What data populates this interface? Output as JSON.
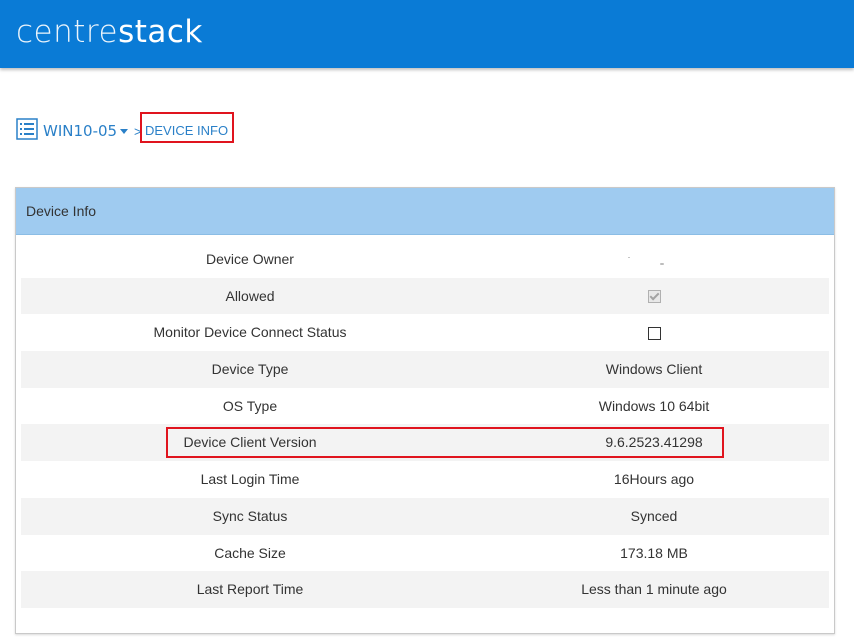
{
  "header": {
    "brand_part1": "centre",
    "brand_part2": "stack"
  },
  "breadcrumb": {
    "device_name": "WIN10-05",
    "separator": ">",
    "current": "DEVICE INFO"
  },
  "panel": {
    "title": "Device Info"
  },
  "rows": [
    {
      "label": "Device Owner",
      "value": ""
    },
    {
      "label": "Allowed",
      "value_type": "checkbox",
      "checked": true,
      "disabled": true
    },
    {
      "label": "Monitor Device Connect Status",
      "value_type": "checkbox",
      "checked": false
    },
    {
      "label": "Device Type",
      "value": "Windows Client"
    },
    {
      "label": "OS Type",
      "value": "Windows 10 64bit"
    },
    {
      "label": "Device Client Version",
      "value": "9.6.2523.41298"
    },
    {
      "label": "Last Login Time",
      "value": "16Hours ago"
    },
    {
      "label": "Sync Status",
      "value": "Synced"
    },
    {
      "label": "Cache Size",
      "value": "173.18 MB"
    },
    {
      "label": "Last Report Time",
      "value": "Less than 1 minute ago"
    }
  ],
  "colors": {
    "header_bg": "#0a7bd6",
    "panel_header_bg": "#9fcbf0",
    "link": "#2a80c8",
    "highlight_border": "#e0141e"
  },
  "icons": {
    "device_list": "list-icon",
    "dropdown": "caret-down-icon"
  }
}
